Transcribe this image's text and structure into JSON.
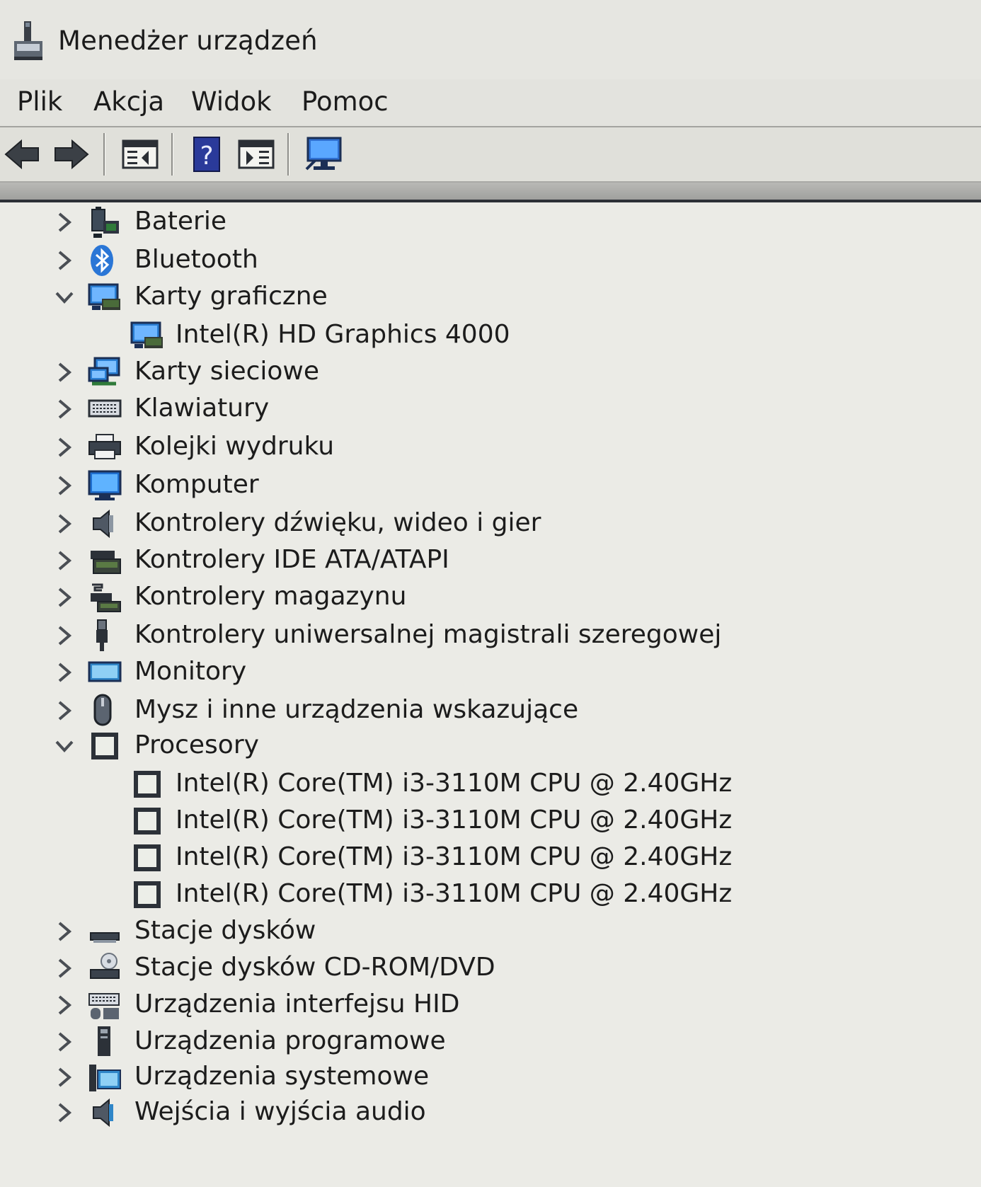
{
  "window": {
    "title": "Menedżer urządzeń"
  },
  "menu": [
    "Plik",
    "Akcja",
    "Widok",
    "Pomoc"
  ],
  "toolbar": {
    "buttons": [
      "back-icon",
      "forward-icon",
      "properties-icon",
      "help-icon",
      "update-driver-icon",
      "scan-hardware-icon"
    ]
  },
  "tree": [
    {
      "label": "Baterie",
      "icon": "battery-icon",
      "level": 1,
      "expanded": false
    },
    {
      "label": "Bluetooth",
      "icon": "bluetooth-icon",
      "level": 1,
      "expanded": false
    },
    {
      "label": "Karty graficzne",
      "icon": "display-adapter-icon",
      "level": 1,
      "expanded": true
    },
    {
      "label": "Intel(R) HD Graphics 4000",
      "icon": "display-adapter-icon",
      "level": 2
    },
    {
      "label": "Karty sieciowe",
      "icon": "network-adapter-icon",
      "level": 1,
      "expanded": false
    },
    {
      "label": "Klawiatury",
      "icon": "keyboard-icon",
      "level": 1,
      "expanded": false
    },
    {
      "label": "Kolejki wydruku",
      "icon": "printer-icon",
      "level": 1,
      "expanded": false
    },
    {
      "label": "Komputer",
      "icon": "computer-icon",
      "level": 1,
      "expanded": false
    },
    {
      "label": "Kontrolery dźwięku, wideo i gier",
      "icon": "speaker-icon",
      "level": 1,
      "expanded": false
    },
    {
      "label": "Kontrolery IDE ATA/ATAPI",
      "icon": "ide-controller-icon",
      "level": 1,
      "expanded": false
    },
    {
      "label": "Kontrolery magazynu",
      "icon": "storage-controller-icon",
      "level": 1,
      "expanded": false
    },
    {
      "label": "Kontrolery uniwersalnej magistrali szeregowej",
      "icon": "usb-icon",
      "level": 1,
      "expanded": false
    },
    {
      "label": "Monitory",
      "icon": "monitor-icon",
      "level": 1,
      "expanded": false
    },
    {
      "label": "Mysz i inne urządzenia wskazujące",
      "icon": "mouse-icon",
      "level": 1,
      "expanded": false
    },
    {
      "label": "Procesory",
      "icon": "processor-icon",
      "level": 1,
      "expanded": true
    },
    {
      "label": "Intel(R) Core(TM) i3-3110M CPU @ 2.40GHz",
      "icon": "processor-icon",
      "level": 2
    },
    {
      "label": "Intel(R) Core(TM) i3-3110M CPU @ 2.40GHz",
      "icon": "processor-icon",
      "level": 2
    },
    {
      "label": "Intel(R) Core(TM) i3-3110M CPU @ 2.40GHz",
      "icon": "processor-icon",
      "level": 2
    },
    {
      "label": "Intel(R) Core(TM) i3-3110M CPU @ 2.40GHz",
      "icon": "processor-icon",
      "level": 2
    },
    {
      "label": "Stacje dysków",
      "icon": "disk-drive-icon",
      "level": 1,
      "expanded": false
    },
    {
      "label": "Stacje dysków CD-ROM/DVD",
      "icon": "dvd-drive-icon",
      "level": 1,
      "expanded": false
    },
    {
      "label": "Urządzenia interfejsu HID",
      "icon": "hid-icon",
      "level": 1,
      "expanded": false
    },
    {
      "label": "Urządzenia programowe",
      "icon": "software-device-icon",
      "level": 1,
      "expanded": false
    },
    {
      "label": "Urządzenia systemowe",
      "icon": "system-device-icon",
      "level": 1,
      "expanded": false
    },
    {
      "label": "Wejścia i wyjścia audio",
      "icon": "audio-io-icon",
      "level": 1,
      "expanded": false
    }
  ]
}
